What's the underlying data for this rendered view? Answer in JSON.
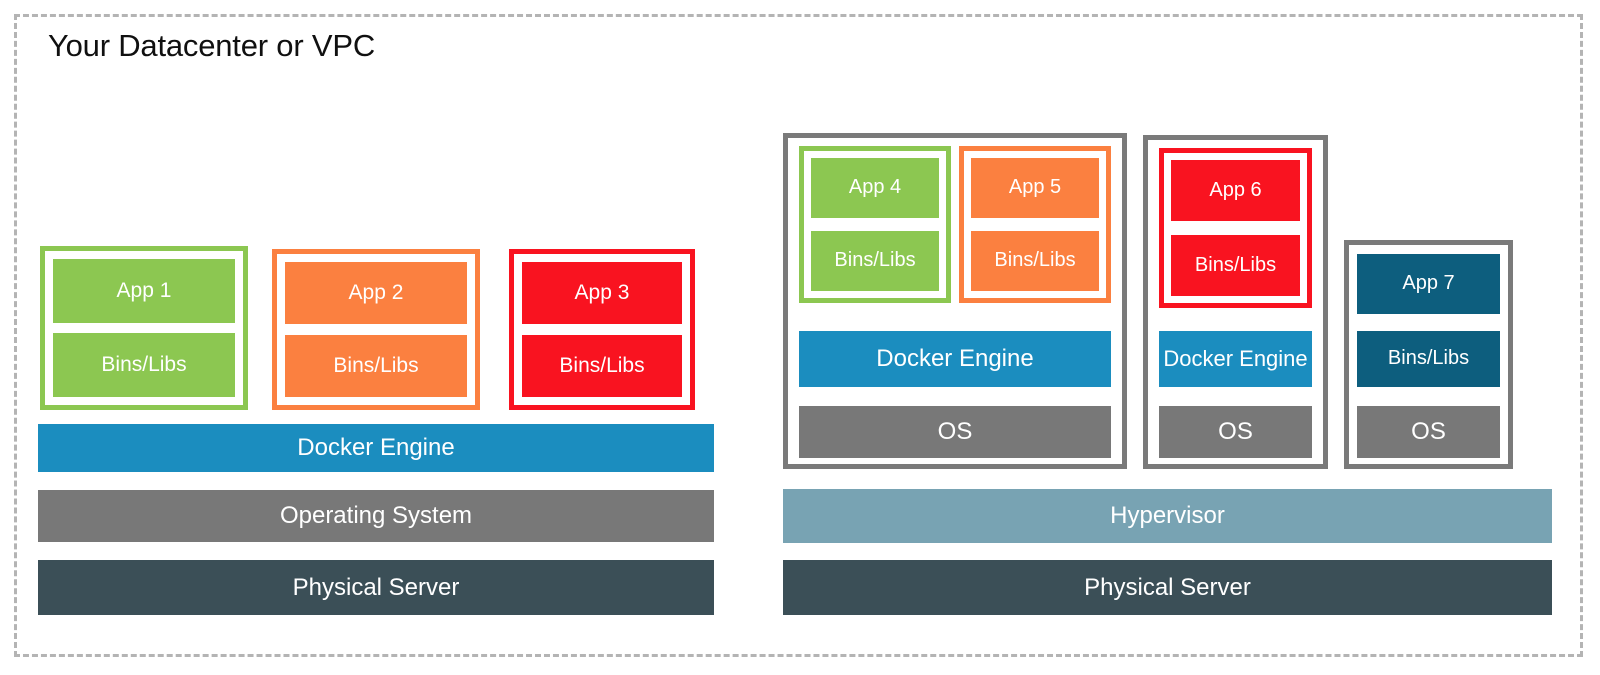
{
  "diagram": {
    "title": "Your Datacenter or VPC",
    "type": "architecture-comparison",
    "description": "Docker containers on bare metal versus containers inside virtual machines on a hypervisor"
  },
  "colors": {
    "green": "#8CC751",
    "orange": "#FB8040",
    "red": "#F91320",
    "teal": "#0D5E7E",
    "docker_blue": "#1B8DBF",
    "os_gray": "#787878",
    "hypervisor": "#78A3B3",
    "physical_server": "#3B4F57",
    "vm_border": "#7A7A7A",
    "dashed_border": "#B4B4B4",
    "title_text": "#101010",
    "label_text": "#FFFFFF",
    "background": "#FFFFFF"
  },
  "left_stack": {
    "name": "bare-metal-docker-host",
    "containers": [
      {
        "app_label": "App 1",
        "bins_label": "Bins/Libs",
        "color_key": "green"
      },
      {
        "app_label": "App 2",
        "bins_label": "Bins/Libs",
        "color_key": "orange"
      },
      {
        "app_label": "App 3",
        "bins_label": "Bins/Libs",
        "color_key": "red"
      }
    ],
    "layers": [
      {
        "label": "Docker Engine",
        "color_key": "docker_blue"
      },
      {
        "label": "Operating System",
        "color_key": "os_gray"
      },
      {
        "label": "Physical Server",
        "color_key": "physical_server"
      }
    ]
  },
  "right_stack": {
    "name": "virtualized-docker-host",
    "vms": [
      {
        "name": "vm-1",
        "containers": [
          {
            "app_label": "App 4",
            "bins_label": "Bins/Libs",
            "color_key": "green"
          },
          {
            "app_label": "App 5",
            "bins_label": "Bins/Libs",
            "color_key": "orange"
          }
        ],
        "layers": [
          {
            "label": "Docker Engine",
            "color_key": "docker_blue"
          },
          {
            "label": "OS",
            "color_key": "os_gray"
          }
        ]
      },
      {
        "name": "vm-2",
        "containers": [
          {
            "app_label": "App 6",
            "bins_label": "Bins/Libs",
            "color_key": "red"
          }
        ],
        "layers": [
          {
            "label": "Docker Engine",
            "color_key": "docker_blue"
          },
          {
            "label": "OS",
            "color_key": "os_gray"
          }
        ]
      },
      {
        "name": "vm-3",
        "containers": [
          {
            "app_label": "App 7",
            "bins_label": "Bins/Libs",
            "color_key": "teal"
          }
        ],
        "layers": [
          {
            "label": "OS",
            "color_key": "os_gray"
          }
        ]
      }
    ],
    "layers": [
      {
        "label": "Hypervisor",
        "color_key": "hypervisor"
      },
      {
        "label": "Physical Server",
        "color_key": "physical_server"
      }
    ]
  }
}
